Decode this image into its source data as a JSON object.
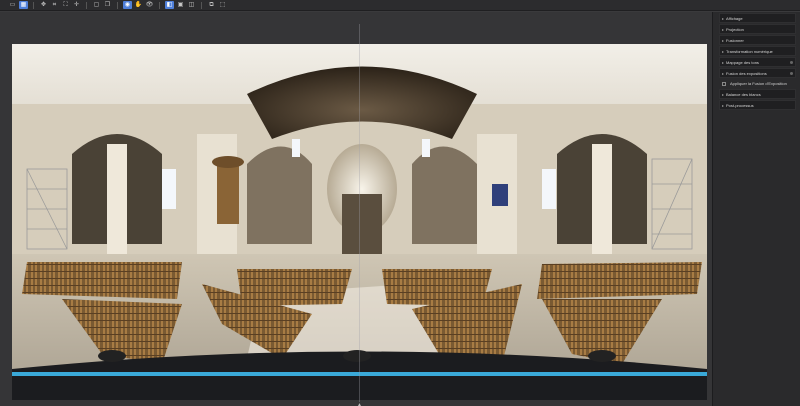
{
  "toolbar": {
    "buttons": [
      {
        "name": "single-view-icon",
        "glyph": "▭",
        "active": false
      },
      {
        "name": "grid-view-icon",
        "glyph": "▦",
        "active": true
      },
      {
        "name": "move-icon",
        "glyph": "✥",
        "active": false
      },
      {
        "name": "crop-icon",
        "glyph": "⌗",
        "active": false
      },
      {
        "name": "fit-icon",
        "glyph": "⛶",
        "active": false
      },
      {
        "name": "crosshair-icon",
        "glyph": "✛",
        "active": false
      },
      {
        "name": "frame-icon",
        "glyph": "▢",
        "active": false
      },
      {
        "name": "copy-icon",
        "glyph": "❐",
        "active": false
      },
      {
        "name": "color-mode-icon",
        "glyph": "◉",
        "active": true
      },
      {
        "name": "pan-icon",
        "glyph": "✋",
        "active": false
      },
      {
        "name": "eye-icon",
        "glyph": "👁",
        "active": false
      },
      {
        "name": "compare-icon",
        "glyph": "◧",
        "active": true
      },
      {
        "name": "split-view-icon",
        "glyph": "▣",
        "active": false
      },
      {
        "name": "mask-icon",
        "glyph": "◫",
        "active": false
      },
      {
        "name": "layers-icon",
        "glyph": "⧉",
        "active": false
      },
      {
        "name": "export-icon",
        "glyph": "⬚",
        "active": false
      }
    ]
  },
  "panel": {
    "sections": [
      {
        "label": "Affichage",
        "extra": false
      },
      {
        "label": "Projection",
        "extra": false
      },
      {
        "label": "Fusionner",
        "extra": false
      },
      {
        "label": "Transformation numérique",
        "extra": false
      },
      {
        "label": "Mappage des tons",
        "extra": true
      },
      {
        "label": "Fusion des expositions",
        "extra": true
      }
    ],
    "option": {
      "label": "Appliquer la Fusion d'Exposition",
      "checked": false
    },
    "sections_after": [
      {
        "label": "Balance des blancs",
        "extra": false
      },
      {
        "label": "Post-processus",
        "extra": false
      }
    ]
  },
  "workspace": {
    "bottom_marker": "▲"
  },
  "colors": {
    "accent": "#4f7fd9",
    "background": "#3a3a3c",
    "panel": "#2a2a2c"
  }
}
